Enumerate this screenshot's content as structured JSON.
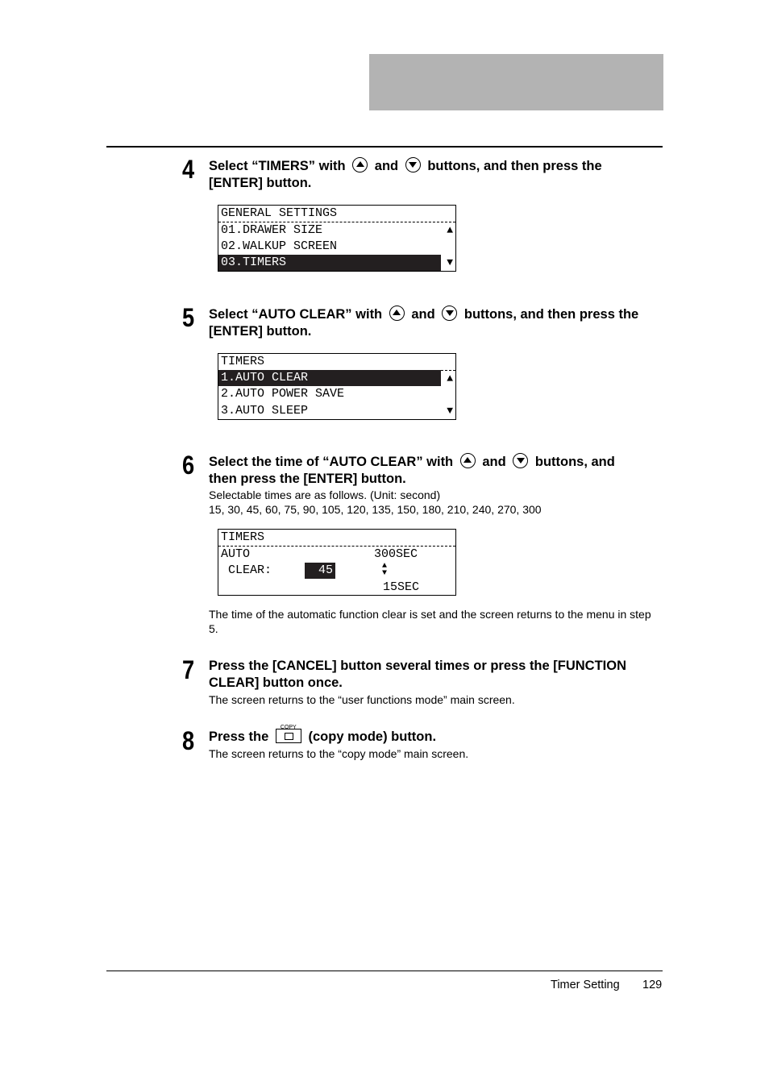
{
  "header": {
    "band_color": "#b3b3b3"
  },
  "steps": [
    {
      "number": "4",
      "line1": [
        "Select “TIMERS” with",
        "and",
        "buttons, and then press the"
      ],
      "line2": "[ENTER] button.",
      "lcd": {
        "title": "GENERAL SETTINGS",
        "rows": [
          "01.DRAWER SIZE",
          "02.WALKUP SCREEN",
          "03.TIMERS"
        ],
        "selected": 2
      }
    },
    {
      "number": "5",
      "line1": [
        "Select “AUTO CLEAR” with",
        "and",
        "buttons, and then press the"
      ],
      "line2": "[ENTER] button.",
      "lcd": {
        "title": "TIMERS",
        "rows": [
          "1.AUTO CLEAR",
          "2.AUTO POWER SAVE",
          "3.AUTO SLEEP"
        ],
        "selected": 0
      }
    },
    {
      "number": "6",
      "line1": [
        "Select the time of “AUTO CLEAR” with",
        "and",
        "buttons, and"
      ],
      "line2": "then press the [ENTER] button.",
      "body1": "Selectable times are as follows. (Unit: second)",
      "body2": "15, 30, 45, 60, 75, 90, 105, 120, 135, 150, 180, 210, 240, 270, 300",
      "lcd": {
        "title": "TIMERS",
        "label1": "AUTO",
        "label2": " CLEAR:",
        "value": "45",
        "max": "300SEC",
        "min": "15SEC"
      },
      "after1": "The time of the automatic function clear is set and the screen returns to the menu in step",
      "after2": "5."
    },
    {
      "number": "7",
      "line1": "Press the [CANCEL] button several times or press the [FUNCTION",
      "line2": "CLEAR] button once.",
      "body": "The screen returns to the “user functions mode” main screen."
    },
    {
      "number": "8",
      "pre": "Press the",
      "button_label": "COPY",
      "post": "(copy mode) button.",
      "body": "The screen returns to the “copy mode” main screen."
    }
  ],
  "footer": {
    "section": "Timer Setting",
    "page": "129"
  }
}
